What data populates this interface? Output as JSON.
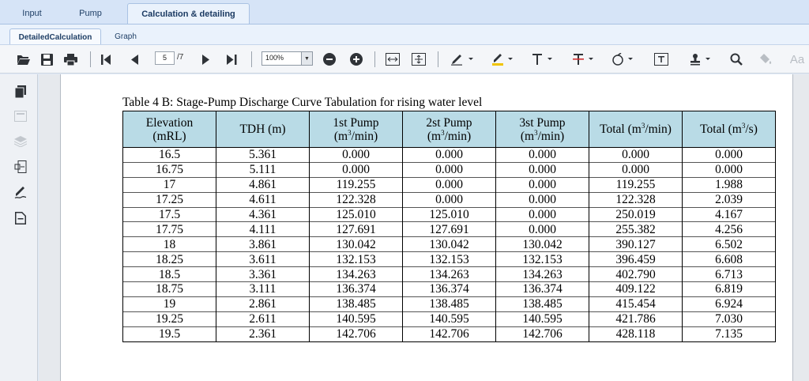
{
  "top_tabs": [
    {
      "label": "Input"
    },
    {
      "label": "Pump"
    },
    {
      "label": "Calculation & detailing"
    }
  ],
  "sub_tabs": [
    {
      "label": "DetailedCalculation"
    },
    {
      "label": "Graph"
    }
  ],
  "toolbar": {
    "page_current": "5",
    "page_total": "/7",
    "zoom": "100%",
    "aa_label": "Aa"
  },
  "document": {
    "caption": "Table 4 B: Stage-Pump Discharge Curve Tabulation for rising water level",
    "headers": [
      {
        "line1": "Elevation",
        "line2": "(mRL)"
      },
      {
        "line1": "TDH (m)",
        "line2": ""
      },
      {
        "line1": "1st Pump",
        "line2": "(m",
        "sup": "3",
        "tail": "/min)"
      },
      {
        "line1": "2st Pump",
        "line2": "(m",
        "sup": "3",
        "tail": "/min)"
      },
      {
        "line1": "3st Pump",
        "line2": "(m",
        "sup": "3",
        "tail": "/min)"
      },
      {
        "line1": "Total (m",
        "sup": "3",
        "tail": "/min)"
      },
      {
        "line1": "Total (m",
        "sup": "3",
        "tail": "/s)"
      }
    ],
    "rows": [
      [
        "16.5",
        "5.361",
        "0.000",
        "0.000",
        "0.000",
        "0.000",
        "0.000"
      ],
      [
        "16.75",
        "5.111",
        "0.000",
        "0.000",
        "0.000",
        "0.000",
        "0.000"
      ],
      [
        "17",
        "4.861",
        "119.255",
        "0.000",
        "0.000",
        "119.255",
        "1.988"
      ],
      [
        "17.25",
        "4.611",
        "122.328",
        "0.000",
        "0.000",
        "122.328",
        "2.039"
      ],
      [
        "17.5",
        "4.361",
        "125.010",
        "125.010",
        "0.000",
        "250.019",
        "4.167"
      ],
      [
        "17.75",
        "4.111",
        "127.691",
        "127.691",
        "0.000",
        "255.382",
        "4.256"
      ],
      [
        "18",
        "3.861",
        "130.042",
        "130.042",
        "130.042",
        "390.127",
        "6.502"
      ],
      [
        "18.25",
        "3.611",
        "132.153",
        "132.153",
        "132.153",
        "396.459",
        "6.608"
      ],
      [
        "18.5",
        "3.361",
        "134.263",
        "134.263",
        "134.263",
        "402.790",
        "6.713"
      ],
      [
        "18.75",
        "3.111",
        "136.374",
        "136.374",
        "136.374",
        "409.122",
        "6.819"
      ],
      [
        "19",
        "2.861",
        "138.485",
        "138.485",
        "138.485",
        "415.454",
        "6.924"
      ],
      [
        "19.25",
        "2.611",
        "140.595",
        "140.595",
        "140.595",
        "421.786",
        "7.030"
      ],
      [
        "19.5",
        "2.361",
        "142.706",
        "142.706",
        "142.706",
        "428.118",
        "7.135"
      ]
    ]
  },
  "colors": {
    "header_fill": "#b9dbe6",
    "tab_bar": "#d6e4f7",
    "highlighter": "#f0c400",
    "strike": "#d03030"
  }
}
